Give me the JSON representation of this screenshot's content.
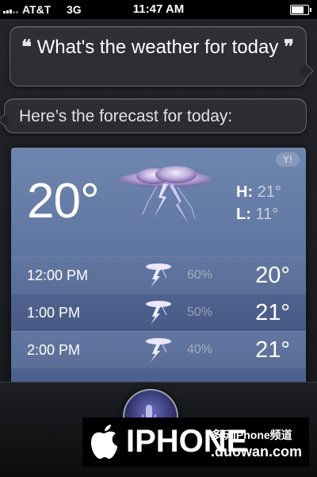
{
  "status_bar": {
    "carrier": "AT&T",
    "network": "3G",
    "time": "11:47 AM",
    "battery_level": 0.8
  },
  "conversation": {
    "user_query": "What's the weather for today",
    "siri_response": "Here’s the forecast for today:"
  },
  "weather": {
    "provider_icon": "yahoo-logo",
    "badge": "Y!",
    "current_temp": "20°",
    "condition_icon": "thunderstorm-icon",
    "high_label": "H:",
    "high": "21°",
    "low_label": "L:",
    "low": "11°",
    "hourly": [
      {
        "time": "12:00 PM",
        "precip": "60%",
        "temp": "20°"
      },
      {
        "time": "1:00 PM",
        "precip": "50%",
        "temp": "21°"
      },
      {
        "time": "2:00 PM",
        "precip": "40%",
        "temp": "21°"
      }
    ],
    "colors": {
      "card_top": "#6f86ae",
      "card_bottom": "#4a6190"
    }
  },
  "watermark": {
    "brand": "IPHONE",
    "chinese": "多玩iPhone频道",
    "domain": ".duowan.com"
  }
}
